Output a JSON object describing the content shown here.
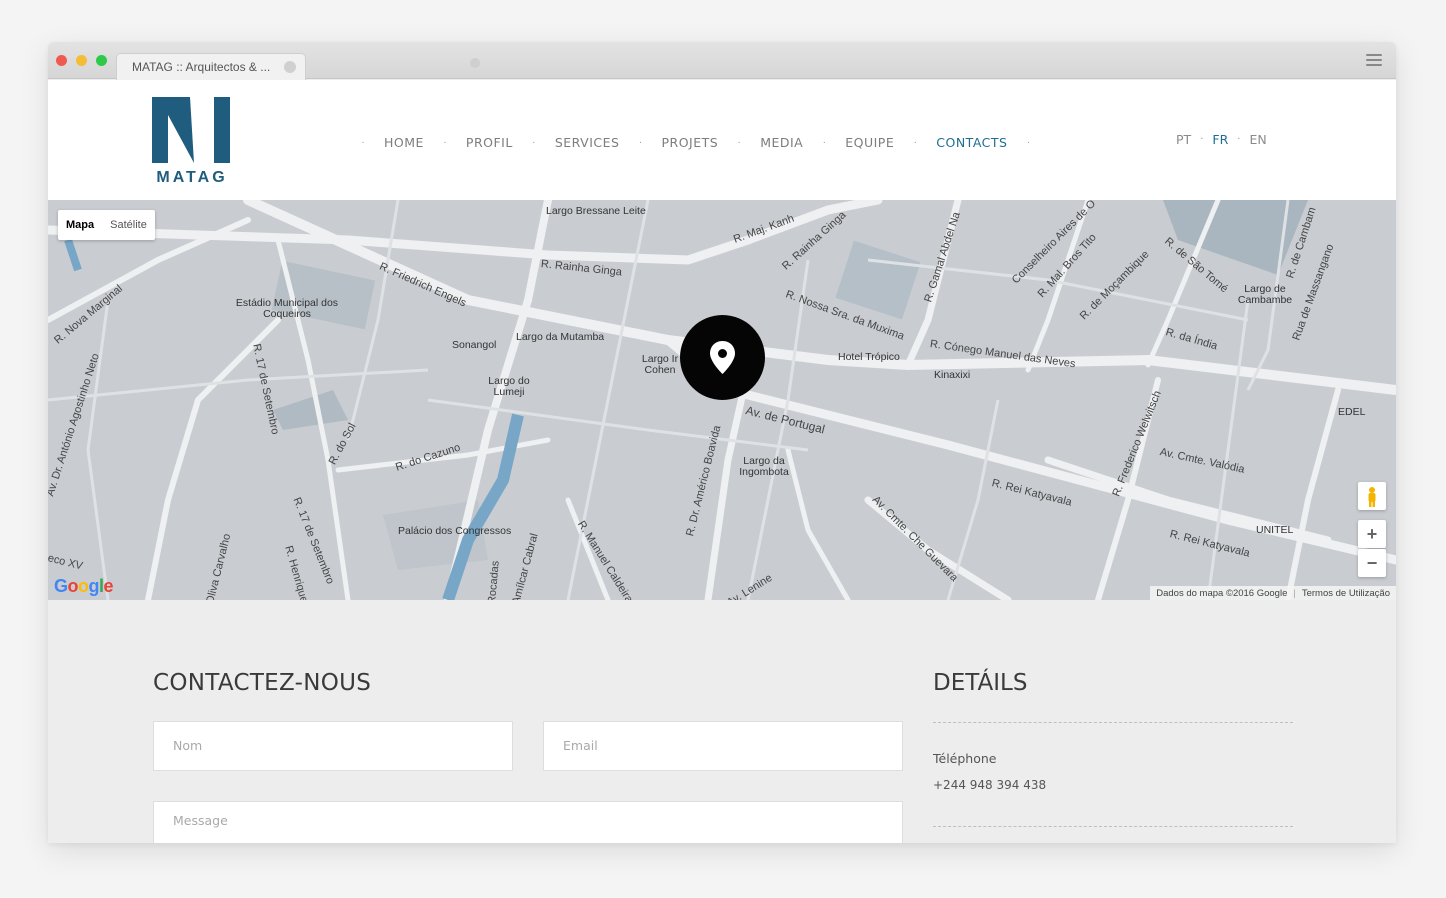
{
  "browser": {
    "tab_title": "MATAG :: Arquitectos & ..."
  },
  "header": {
    "logo_text": "MATAG",
    "brand_color": "#1f5c7d",
    "nav": [
      "HOME",
      "PROFIL",
      "SERVICES",
      "PROJETS",
      "MEDIA",
      "EQUIPE",
      "CONTACTS"
    ],
    "active_nav": "CONTACTS",
    "languages": [
      "PT",
      "FR",
      "EN"
    ],
    "active_language": "FR"
  },
  "map": {
    "type_controls": {
      "map": "Mapa",
      "satellite": "Satélite"
    },
    "zoom_in": "+",
    "zoom_out": "−",
    "google": "Google",
    "attribution": "Dados do mapa ©2016 Google",
    "terms": "Termos de Utilização",
    "places": {
      "largo_bressane": "Largo Bressane Leite",
      "estadio": "Estádio Municipal dos Coqueiros",
      "sonangol": "Sonangol",
      "largo_mutamba": "Largo da Mutamba",
      "largo_cohen": "Largo Ir Cohen",
      "largo_lumeji": "Largo do Lumeji",
      "hotel_tropico": "Hotel Trópico",
      "kinaxixi": "Kinaxixi",
      "largo_ingombota": "Largo da Ingombota",
      "palacio": "Palácio dos Congressos",
      "largo_cambambe": "Largo de Cambambe",
      "edel": "EDEL",
      "unitel": "UNITEL"
    },
    "roads": {
      "rainha_ginga": "R. Rainha Ginga",
      "friedrich_engels": "R. Friedrich Engels",
      "maj_kanhangulo": "R. Maj. Kanh",
      "rainha_ginga_2": "R. Rainha Ginga",
      "nossa_sra": "R. Nossa Sra. da Muxima",
      "conego": "R. Cónego Manuel das Neves",
      "av_portugal": "Av. de Portugal",
      "rei_katyavala": "R. Rei Katyavala",
      "rei_katyavala_2": "R. Rei Katyavala",
      "cmte_valodia": "Av. Cmte. Valódia",
      "che_guevara": "Av. Cmte. Che Guevara",
      "americo_boavida": "R. Dr. Américo Boavida",
      "manuel_caldeira": "R. Manuel Caldeira",
      "do_cazuno": "R. do Cazuno",
      "do_sol": "R. do Sol",
      "setembro": "R. 17 de Setembro",
      "setembro_2": "R. 17 de Setembro",
      "nova_marginal": "R. Nova Marginal",
      "agostinho_neto": "Av. Dr. António Agostinho Neto",
      "frederico_welwitsch": "R. Frederico Welwitsch",
      "da_india": "R. da Índia",
      "mocambique": "R. de Moçambique",
      "sao_tome": "R. de São Tomé",
      "massangano": "Rua de Massangano",
      "gamal": "R. Gamal Abdel Na",
      "conselheiro": "Conselheiro Aires de O",
      "mal_bros_tito": "R. Mal. Bros Tito",
      "lenine": "Av. Lenine",
      "amilcar": "Amílcar Cabral",
      "rocadas": "Rocadas",
      "carvalho": "Oliva Carvalho",
      "henrique": "R. Henrique",
      "cambam": "R. de Cambam",
      "xv": "eco XV"
    }
  },
  "contact": {
    "title": "CONTACTEZ-NOUS",
    "name_placeholder": "Nom",
    "email_placeholder": "Email",
    "message_placeholder": "Message",
    "details_title": "DETÁILS",
    "phone_label": "Téléphone",
    "phone_value": "+244 948 394 438"
  }
}
